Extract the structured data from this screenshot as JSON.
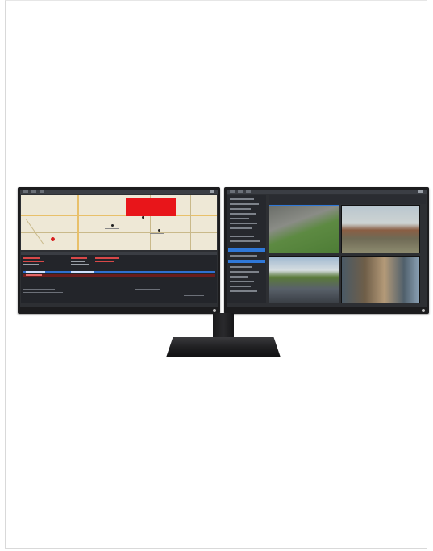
{
  "product": {
    "image_description_name": "dual-monitor-display",
    "left_screen": {
      "map": {
        "alert_label": ""
      }
    }
  },
  "colors": {
    "alert": "#e8151a",
    "selection": "#2f78d8",
    "bezel": "#1c1c1e",
    "app_background": "#2d2f33"
  }
}
